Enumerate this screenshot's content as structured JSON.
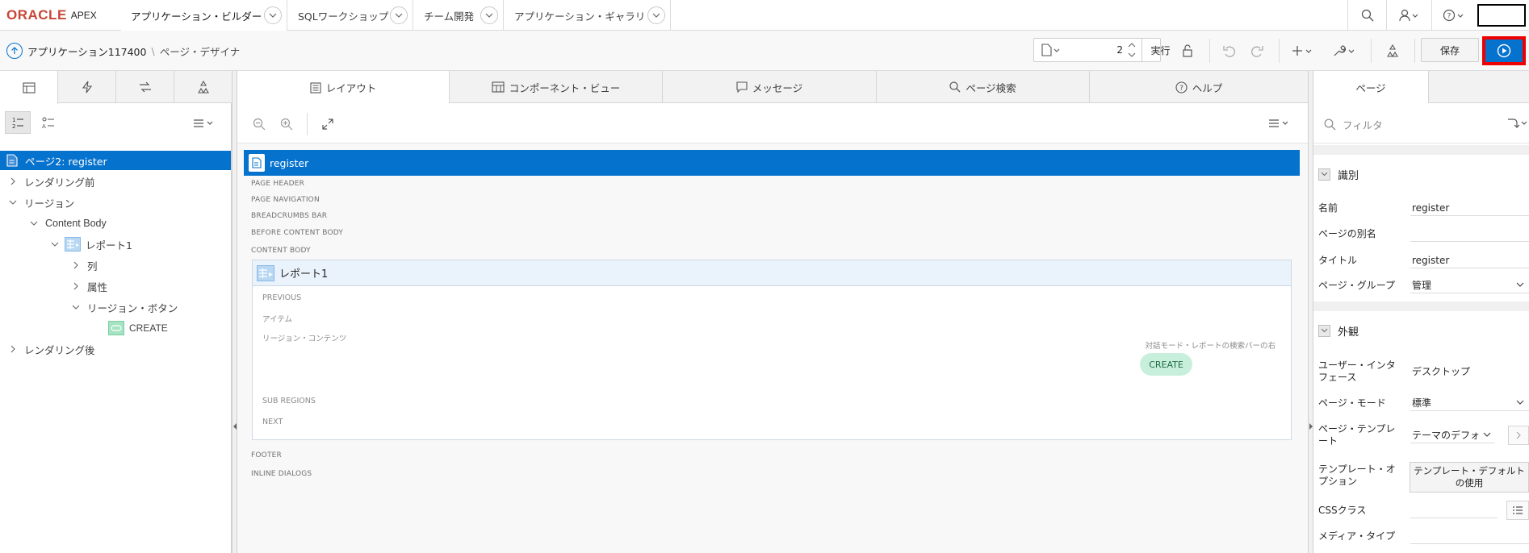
{
  "app": {
    "logo_oracle": "ORACLE",
    "logo_apex": "APEX"
  },
  "top_tabs": [
    {
      "label": "アプリケーション・ビルダー"
    },
    {
      "label": "SQLワークショップ"
    },
    {
      "label": "チーム開発"
    },
    {
      "label": "アプリケーション・ギャラリ"
    }
  ],
  "toolbar": {
    "breadcrumb_app": "アプリケーション117400",
    "breadcrumb_sep": "\\",
    "breadcrumb_page": "ページ・デザイナ",
    "page_number": "2",
    "run_label": "実行",
    "save_label": "保存"
  },
  "left_tree": {
    "root": "ページ2: register",
    "before_render": "レンダリング前",
    "regions": "リージョン",
    "content_body": "Content Body",
    "report": "レポート1",
    "columns": "列",
    "attributes": "属性",
    "region_buttons": "リージョン・ボタン",
    "create": "CREATE",
    "after_render": "レンダリング後"
  },
  "center_tabs": [
    {
      "label": "レイアウト"
    },
    {
      "label": "コンポーネント・ビュー"
    },
    {
      "label": "メッセージ"
    },
    {
      "label": "ページ検索"
    },
    {
      "label": "ヘルプ"
    }
  ],
  "layout": {
    "page_name": "register",
    "slots": [
      "PAGE HEADER",
      "PAGE NAVIGATION",
      "BREADCRUMBS BAR",
      "BEFORE CONTENT BODY",
      "CONTENT BODY"
    ],
    "region_title": "レポート1",
    "region_slots": {
      "previous": "PREVIOUS",
      "items": "アイテム",
      "contents": "リージョン・コンテンツ",
      "sub_regions": "SUB REGIONS",
      "next": "NEXT"
    },
    "button_position": "対話モード・レポートの検索バーの右",
    "button_label": "CREATE",
    "footer": "FOOTER",
    "inline_dialogs": "INLINE DIALOGS"
  },
  "right_pane": {
    "tab": "ページ",
    "filter_placeholder": "フィルタ",
    "identification": {
      "heading": "識別",
      "name_label": "名前",
      "name_value": "register",
      "alias_label": "ページの別名",
      "alias_value": "",
      "title_label": "タイトル",
      "title_value": "register",
      "group_label": "ページ・グループ",
      "group_value": "管理"
    },
    "appearance": {
      "heading": "外観",
      "ui_label": "ユーザー・インタフェース",
      "ui_value": "デスクトップ",
      "mode_label": "ページ・モード",
      "mode_value": "標準",
      "template_label": "ページ・テンプレート",
      "template_value": "テーマのデフォ",
      "template_options_label": "テンプレート・オプション",
      "template_options_value": "テンプレート・デフォルトの使用",
      "css_label": "CSSクラス",
      "css_value": "",
      "media_label": "メディア・タイプ",
      "media_value": ""
    }
  },
  "colors": {
    "accent": "#0572ce",
    "oracle_red": "#c74634",
    "highlight_border": "#ee0000",
    "button_green": "#c8efdc"
  }
}
